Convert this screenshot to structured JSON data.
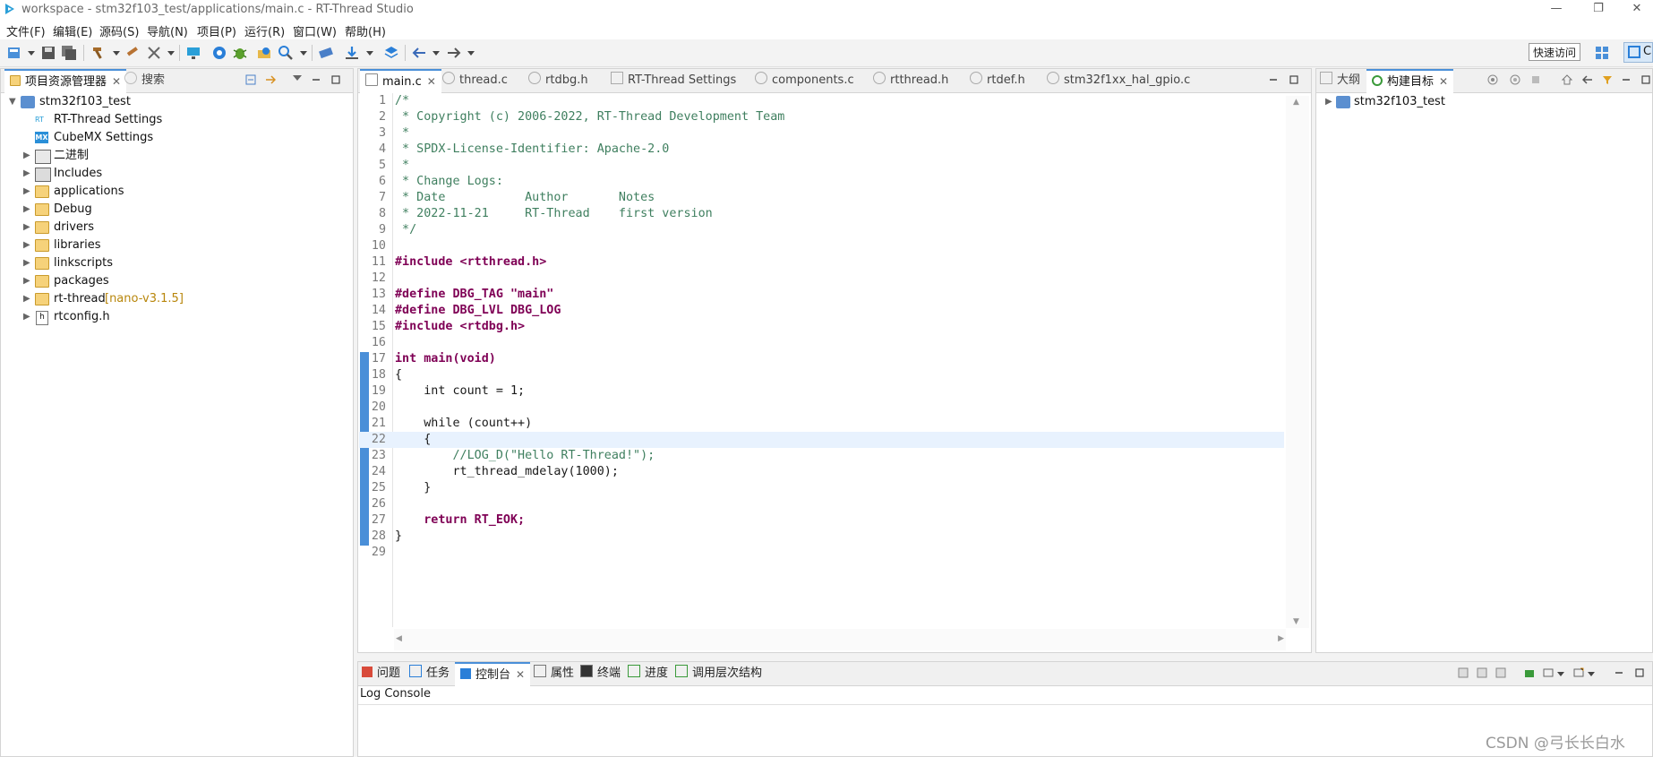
{
  "window": {
    "title": "workspace - stm32f103_test/applications/main.c - RT-Thread Studio",
    "minimize": "—",
    "restore": "❐",
    "close": "✕"
  },
  "menu": [
    "文件(F)",
    "编辑(E)",
    "源码(S)",
    "导航(N)",
    "项目(P)",
    "运行(R)",
    "窗口(W)",
    "帮助(H)"
  ],
  "toolbar": {
    "quick_access": "快速访问",
    "perspective_label": "C"
  },
  "project_explorer": {
    "tab_label": "项目资源管理器",
    "search_tab": "搜索",
    "project": "stm32f103_test",
    "items": [
      {
        "label": "RT-Thread Settings",
        "icon": "rt-settings-icon"
      },
      {
        "label": "CubeMX Settings",
        "icon": "cubemx-icon"
      },
      {
        "label": "二进制",
        "icon": "binaries-icon"
      },
      {
        "label": "Includes",
        "icon": "includes-icon"
      },
      {
        "label": "applications",
        "icon": "folder-icon"
      },
      {
        "label": "Debug",
        "icon": "folder-icon"
      },
      {
        "label": "drivers",
        "icon": "folder-icon"
      },
      {
        "label": "libraries",
        "icon": "folder-icon"
      },
      {
        "label": "linkscripts",
        "icon": "folder-icon"
      },
      {
        "label": "packages",
        "icon": "folder-icon"
      },
      {
        "label": "rt-thread",
        "icon": "folder-icon",
        "suffix": "[nano-v3.1.5]"
      },
      {
        "label": "rtconfig.h",
        "icon": "header-file-icon"
      }
    ]
  },
  "editor": {
    "tabs": [
      "main.c",
      "thread.c",
      "rtdbg.h",
      "RT-Thread Settings",
      "components.c",
      "rtthread.h",
      "rtdef.h",
      "stm32f1xx_hal_gpio.c"
    ],
    "active_tab": "main.c",
    "lines": [
      "/*",
      " * Copyright (c) 2006-2022, RT-Thread Development Team",
      " *",
      " * SPDX-License-Identifier: Apache-2.0",
      " *",
      " * Change Logs:",
      " * Date           Author       Notes",
      " * 2022-11-21     RT-Thread    first version",
      " */",
      "",
      "#include <rtthread.h>",
      "",
      "#define DBG_TAG \"main\"",
      "#define DBG_LVL DBG_LOG",
      "#include <rtdbg.h>",
      "",
      "int main(void)",
      "{",
      "    int count = 1;",
      "",
      "    while (count++)",
      "    {",
      "        //LOG_D(\"Hello RT-Thread!\");",
      "        rt_thread_mdelay(1000);",
      "    }",
      "",
      "    return RT_EOK;",
      "}",
      ""
    ],
    "line_numbers": [
      "1",
      "2",
      "3",
      "4",
      "5",
      "6",
      "7",
      "8",
      "9",
      "10",
      "11",
      "12",
      "13",
      "14",
      "15",
      "16",
      "17",
      "18",
      "19",
      "20",
      "21",
      "22",
      "23",
      "24",
      "25",
      "26",
      "27",
      "28",
      "29"
    ]
  },
  "outline": {
    "tab_outline": "大纲",
    "tab_build_targets": "构建目标",
    "project": "stm32f103_test"
  },
  "bottom_panel": {
    "tabs": [
      "问题",
      "任务",
      "控制台",
      "属性",
      "终端",
      "进度",
      "调用层次结构"
    ],
    "active_tab": "控制台",
    "console_title": "Log Console"
  },
  "watermark": "CSDN @弓长长白水",
  "colors": {
    "accent": "#4a8fd8",
    "keyword": "#7f0055",
    "comment": "#3f7f5f",
    "string": "#2a00ff",
    "current_line": "#e8f2fe"
  }
}
